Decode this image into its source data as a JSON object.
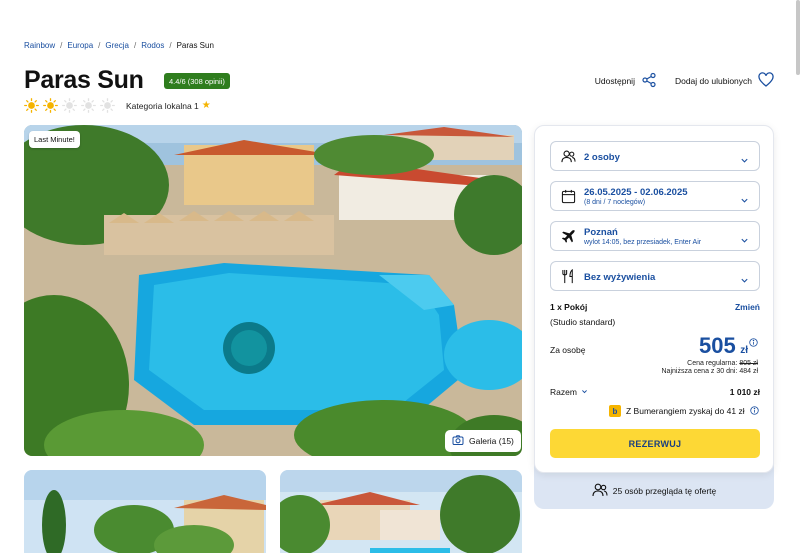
{
  "breadcrumb": {
    "items": [
      "Rainbow",
      "Europa",
      "Grecja",
      "Rodos"
    ],
    "current": "Paras Sun"
  },
  "hotel": {
    "name": "Paras Sun",
    "rating_badge": "4.4/6 (308 opinii)",
    "suns_filled": 2,
    "suns_total": 5,
    "category_label": "Kategoria lokalna 1"
  },
  "actions": {
    "share_label": "Udostępnij",
    "favorite_label": "Dodaj do ulubionych"
  },
  "photo": {
    "badge": "Last Minute!",
    "gallery_label": "Galeria (15)"
  },
  "booking": {
    "persons": "2 osoby",
    "dates": "26.05.2025 - 02.06.2025",
    "dates_sub": "(8 dni / 7 noclegów)",
    "departure": "Poznań",
    "departure_sub": "wylot 14:05, bez przesiadek, Enter Air",
    "board": "Bez wyżywienia",
    "room_count": "1 x Pokój",
    "change_label": "Zmień",
    "room_type": "(Studio standard)",
    "per_person_label": "Za osobę",
    "price": "505",
    "currency": "zł",
    "regular_label": "Cena regularna:",
    "regular_price": "805 zł",
    "lowest_label": "Najniższa cena z 30 dni: 484 zł",
    "total_label": "Razem",
    "total_value": "1 010 zł",
    "bumerang_text": "Z Bumerangiem zyskaj do 41 zł",
    "reserve_label": "REZERWUJ",
    "viewers_text": "25 osób przegląda tę ofertę"
  },
  "colors": {
    "brand_blue": "#1a4fa0",
    "rating_green": "#2f7d1e",
    "reserve_yellow": "#fdd835"
  }
}
